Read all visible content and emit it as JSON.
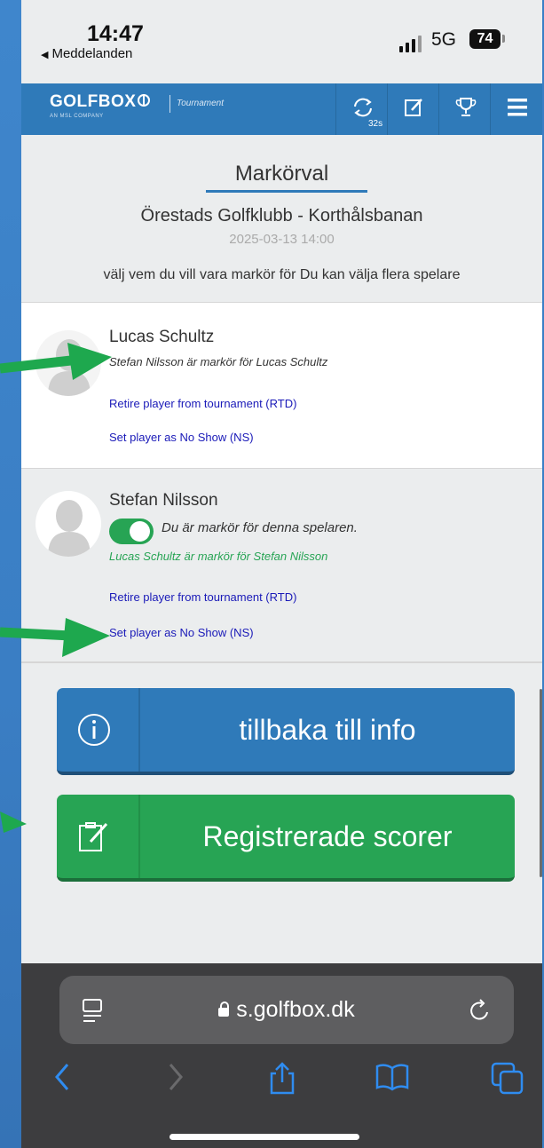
{
  "status_bar": {
    "time": "14:47",
    "back_app": "Meddelanden",
    "network": "5G",
    "battery": "74"
  },
  "header": {
    "logo": "GOLFBOX",
    "logo_sub": "AN MSL COMPANY",
    "section": "Tournament",
    "refresh_count": "32s",
    "icons": [
      "refresh-icon",
      "scorecard-icon",
      "trophy-icon",
      "menu-icon"
    ]
  },
  "page": {
    "title": "Markörval",
    "club": "Örestads Golfklubb - Korthålsbanan",
    "datetime": "2025-03-13 14:00",
    "instruction": "välj vem du vill vara markör för Du kan välja flera spelare"
  },
  "players": [
    {
      "name": "Lucas Schultz",
      "marker_text": "Stefan Nilsson är markör för Lucas Schultz",
      "rtd_link": "Retire player from tournament (RTD)",
      "ns_link": "Set player as No Show (NS)"
    },
    {
      "name": "Stefan Nilsson",
      "toggle_label": "Du är markör för denna spelaren.",
      "toggle_on": true,
      "marker_text": "Lucas Schultz är markör för Stefan Nilsson",
      "rtd_link": "Retire player from tournament (RTD)",
      "ns_link": "Set player as No Show (NS)"
    }
  ],
  "buttons": {
    "info_label": "tillbaka till info",
    "scores_label": "Registrerade scorer"
  },
  "browser": {
    "url": "s.golfbox.dk"
  },
  "colors": {
    "brand_blue": "#2f7ab9",
    "success_green": "#27a454",
    "link_blue": "#1a1ab8",
    "annotation_green": "#1ea84e"
  }
}
